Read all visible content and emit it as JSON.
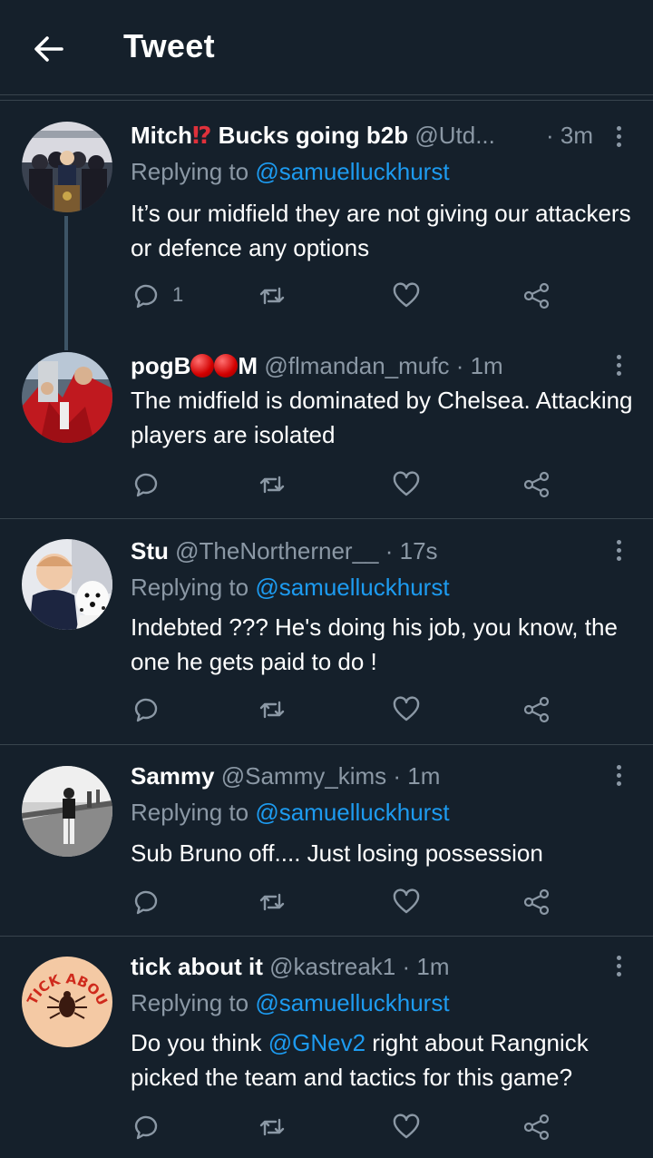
{
  "header": {
    "title": "Tweet",
    "back_icon": "arrow-left-icon"
  },
  "colors": {
    "background": "#15202b",
    "link": "#1d9bf0",
    "muted": "#8b98a5",
    "separator": "#38444d"
  },
  "tweets": [
    {
      "name_a": "Mitch",
      "name_emoji": "⁉",
      "name_b": " Bucks going b2b",
      "handle": "@Utd...",
      "time": "· 3m",
      "replying_prefix": "Replying to",
      "replying_to": "@samuelluckhurst",
      "text": "It’s our midfield they are not giving our attackers or defence any options",
      "reply_count": "1"
    },
    {
      "name_a": "pogB",
      "name_b": "M",
      "handle": "@flmandan_mufc",
      "time": "· 1m",
      "text": "The midfield is dominated by Chelsea. Attacking players are isolated"
    },
    {
      "name": "Stu",
      "handle": "@TheNortherner__",
      "time": "· 17s",
      "replying_prefix": "Replying to",
      "replying_to": "@samuelluckhurst",
      "text": "Indebted ??? He's doing his job, you know, the one he gets paid to do !"
    },
    {
      "name": "Sammy",
      "handle": "@Sammy_kims",
      "time": "· 1m",
      "replying_prefix": "Replying to",
      "replying_to": "@samuelluckhurst",
      "text": "Sub Bruno off.... Just losing possession"
    },
    {
      "name": "tick about it",
      "handle": "@kastreak1",
      "time": "· 1m",
      "replying_prefix": "Replying to",
      "replying_to": "@samuelluckhurst",
      "text_a": "Do you think ",
      "mention": "@GNev2",
      "text_b": " right about Rangnick picked the team and tactics for this game?",
      "avatar_text": "TICK ABOUT IT"
    }
  ]
}
